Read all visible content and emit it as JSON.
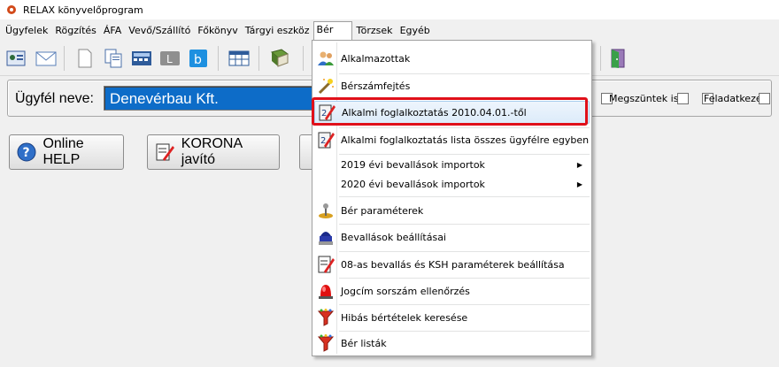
{
  "window": {
    "title": "RELAX könyvelőprogram"
  },
  "menubar": {
    "items": [
      "Ügyfelek",
      "Rögzítés",
      "ÁFA",
      "Vevő/Szállító",
      "Főkönyv",
      "Tárgyi eszköz",
      "Bér",
      "Törzsek",
      "Egyéb"
    ],
    "active": "Bér"
  },
  "client": {
    "label": "Ügyfél neve:",
    "value": "Denevérbau Kft.",
    "checkbox1_label": "Megszüntek is",
    "checkbox2_label": "Feladatkezelő"
  },
  "buttons": {
    "help": "Online HELP",
    "korona": "KORONA javító"
  },
  "dropdown": {
    "items": [
      {
        "label": "Alkalmazottak",
        "icon": "people-icon"
      },
      {
        "label": "Bérszámfejtés",
        "icon": "magic-wand-icon"
      },
      {
        "label": "Alkalmi foglalkoztatás 2010.04.01.-től",
        "icon": "edit-document-icon"
      },
      {
        "label": "Alkalmi foglalkoztatás lista összes ügyfélre egyben",
        "icon": "edit-document-icon"
      },
      {
        "label": "2019 évi bevallások importok",
        "icon": "",
        "submenu": true
      },
      {
        "label": "2020 évi bevallások importok",
        "icon": "",
        "submenu": true
      },
      {
        "label": "Bér paraméterek",
        "icon": "joystick-icon"
      },
      {
        "label": "Bevallások beállításai",
        "icon": "stamp-icon"
      },
      {
        "label": "08-as bevallás és KSH paraméterek beállítása",
        "icon": "edit-form-icon"
      },
      {
        "label": "Jogcím sorszám ellenőrzés",
        "icon": "alarm-light-icon"
      },
      {
        "label": "Hibás bértételek keresése",
        "icon": "funnel-icon"
      },
      {
        "label": "Bér listák",
        "icon": "funnel-icon"
      }
    ],
    "highlighted_index": 2,
    "highlight_color": "#e0101a"
  }
}
